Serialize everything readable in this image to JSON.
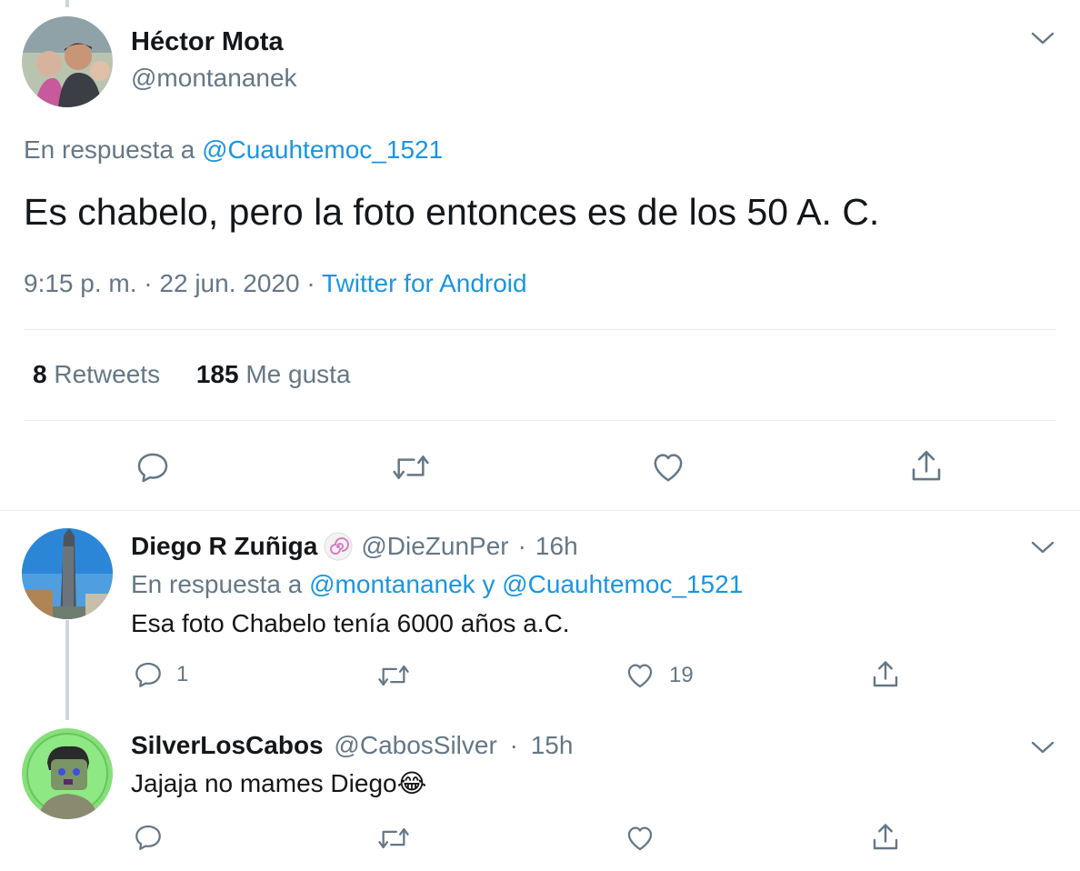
{
  "main_tweet": {
    "name": "Héctor Mota",
    "handle": "@montananek",
    "reply_prefix": "En respuesta a",
    "reply_to": "@Cuauhtemoc_1521",
    "text": "Es chabelo, pero la foto entonces es de los 50 A. C.",
    "time": "9:15 p. m.",
    "separator": "·",
    "date": "22 jun. 2020",
    "source": "Twitter for Android",
    "retweets_count": "8",
    "retweets_label": "Retweets",
    "likes_count": "185",
    "likes_label": "Me gusta"
  },
  "replies": [
    {
      "name": "Diego R Zuñiga",
      "handle": "@DieZunPer",
      "separator": "·",
      "time": "16h",
      "reply_prefix": "En respuesta a",
      "reply_to_1": "@montananek",
      "reply_joiner": "y",
      "reply_to_2": "@Cuauhtemoc_1521",
      "text": "Esa foto Chabelo tenía 6000 años a.C.",
      "reply_count": "1",
      "like_count": "19"
    },
    {
      "name": "SilverLosCabos",
      "handle": "@CabosSilver",
      "separator": "·",
      "time": "15h",
      "text": "Jajaja no mames Diego",
      "emoji": "😂"
    }
  ],
  "colors": {
    "link": "#1b95e0",
    "muted": "#657786",
    "text": "#14171a",
    "divider": "#e6ecf0"
  }
}
